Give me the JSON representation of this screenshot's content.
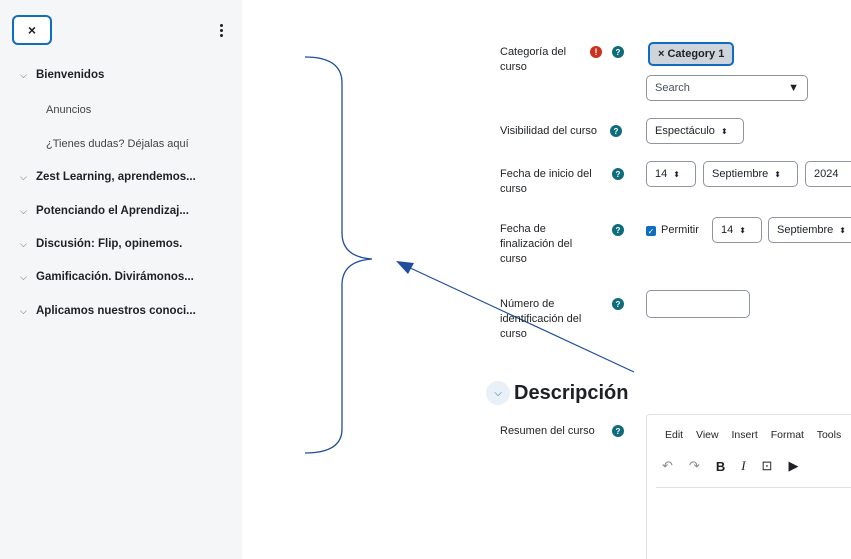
{
  "sidebar": {
    "close_label": "×",
    "items": [
      {
        "label": "Bienvenidos",
        "type": "section"
      },
      {
        "label": "Anuncios",
        "type": "sub"
      },
      {
        "label": "¿Tienes dudas? Déjalas aquí",
        "type": "sub"
      },
      {
        "label": "Zest Learning, aprendemos...",
        "type": "section"
      },
      {
        "label": "Potenciando el Aprendizaj...",
        "type": "section"
      },
      {
        "label": "Discusión: Flip, opinemos.",
        "type": "section"
      },
      {
        "label": "Gamificación. Divirámonos...",
        "type": "section"
      },
      {
        "label": "Aplicamos nuestros conoci...",
        "type": "section"
      }
    ]
  },
  "form": {
    "category": {
      "label_line1": "Categoría del",
      "label_line2": "curso",
      "chip": "× Category 1",
      "search_placeholder": "Search"
    },
    "visibility": {
      "label": "Visibilidad del curso",
      "value": "Espectáculo"
    },
    "start_date": {
      "label_line1": "Fecha de inicio del",
      "label_line2": "curso",
      "day": "14",
      "month": "Septiembre",
      "year": "2024"
    },
    "end_date": {
      "label_line1": "Fecha de",
      "label_line2": "finalización del",
      "label_line3": "curso",
      "enable_label": "Permitir",
      "day": "14",
      "month": "Septiembre"
    },
    "id_number": {
      "label_line1": "Número de",
      "label_line2": "identificación del",
      "label_line3": "curso",
      "value": ""
    }
  },
  "description": {
    "section_title": "Descripción",
    "summary_label": "Resumen del curso",
    "editor_menu": [
      "Edit",
      "View",
      "Insert",
      "Format",
      "Tools"
    ]
  },
  "colors": {
    "accent": "#0f6cbf",
    "help_icon": "#0f6c7a",
    "required_icon": "#ca3120",
    "annotation": "#1f4e9c"
  }
}
